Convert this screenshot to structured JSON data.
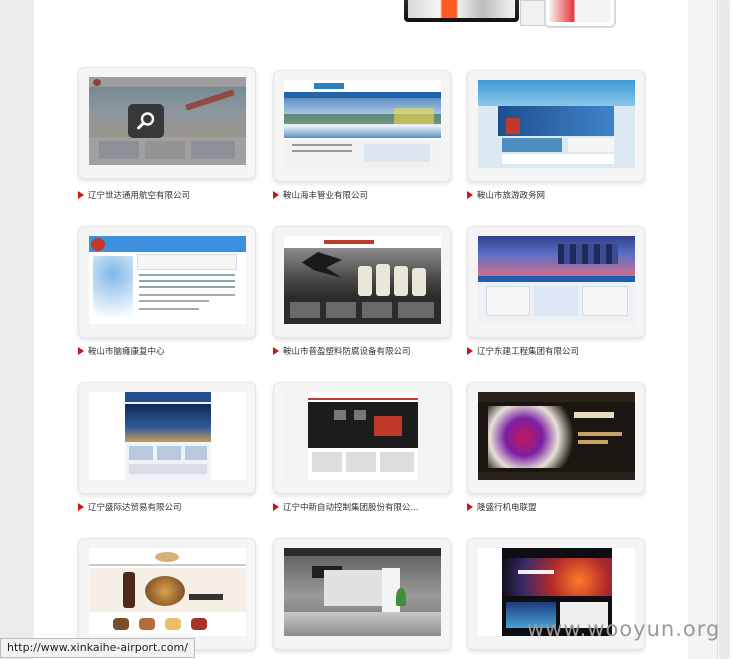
{
  "grid": {
    "items": [
      {
        "title": "辽宁世达通用航空有限公司",
        "theme": "airline",
        "hovered": true
      },
      {
        "title": "鞍山海丰管业有限公司",
        "theme": "pipe"
      },
      {
        "title": "鞍山市旅游政务网",
        "theme": "tourism"
      },
      {
        "title": "鞍山市脑瘫康复中心",
        "theme": "rehab"
      },
      {
        "title": "鞍山市普盈塑料防腐设备有限公司",
        "theme": "plastic"
      },
      {
        "title": "辽宁东建工程集团有限公司",
        "theme": "construction"
      },
      {
        "title": "辽宁盛际达贸易有限公司",
        "theme": "trade"
      },
      {
        "title": "辽宁中新自动控制集团股份有限公...",
        "theme": "control"
      },
      {
        "title": "隆盛行机电联盟",
        "theme": "electro"
      },
      {
        "title": "",
        "theme": "bakery"
      },
      {
        "title": "",
        "theme": "interior"
      },
      {
        "title": "",
        "theme": "automotive"
      }
    ]
  },
  "status_bar": {
    "url": "http://www.xinkaihe-airport.com/"
  },
  "watermark": {
    "text": "www.wooyun.org"
  },
  "icons": {
    "zoom": "search-icon",
    "bullet": "triangle-bullet-icon"
  },
  "colors": {
    "bullet": "#d0121b",
    "overlay": "#5a5a5a",
    "page_bg": "#ffffff",
    "outer_bg": "#ececec"
  }
}
